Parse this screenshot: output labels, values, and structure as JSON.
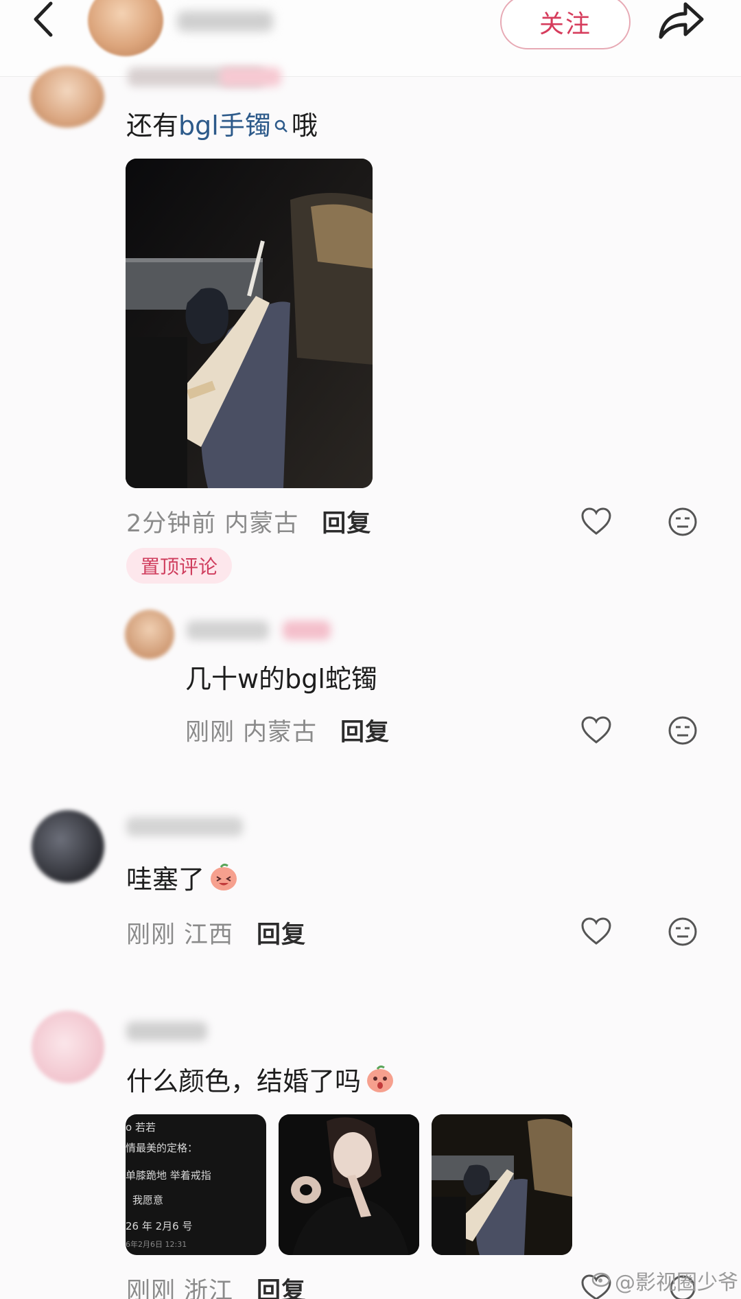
{
  "header": {
    "follow_label": "关注",
    "icons": [
      "back-arrow-icon",
      "share-icon"
    ]
  },
  "comments": [
    {
      "text_before_link": "还有 ",
      "link_text": "bgl手镯",
      "text_after_link": " 哦",
      "time": "2分钟前",
      "location": "内蒙古",
      "reply_label": "回复",
      "pinned_label": "置顶评论"
    },
    {
      "text": "几十w的bgl蛇镯",
      "time": "刚刚",
      "location": "内蒙古",
      "reply_label": "回复"
    },
    {
      "text": "哇塞了",
      "time": "刚刚",
      "location": "江西",
      "reply_label": "回复"
    },
    {
      "text": "什么颜色，结婚了吗",
      "time": "刚刚",
      "location": "浙江",
      "reply_label": "回复",
      "screenshot_lines": [
        "o 若若",
        "情最美的定格：",
        "单膝跪地  举着戒指",
        "我愿意",
        "26 年 2月6 号",
        "6年2月6日 12:31"
      ]
    }
  ],
  "watermark": "@影视圈少爷",
  "colors": {
    "accent": "#d63c5c",
    "pin_bg": "#fde7ec",
    "link": "#2d5a8a",
    "meta": "#8a8a8a"
  }
}
